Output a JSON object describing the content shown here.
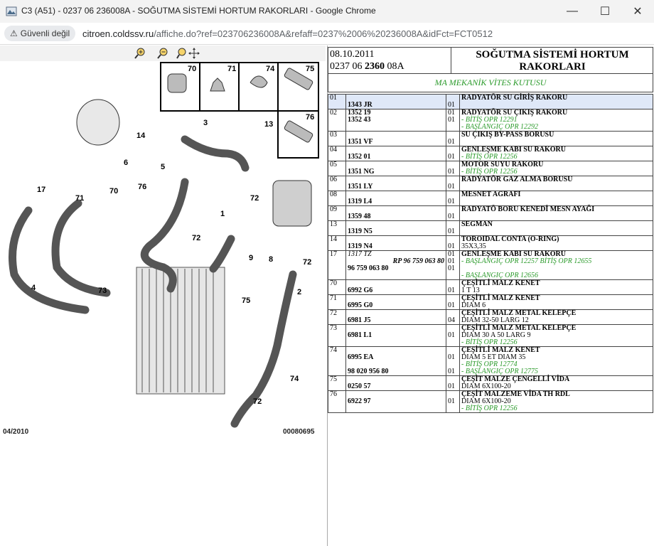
{
  "window": {
    "title": "C3 (A51) - 0237 06 236008A - SOĞUTMA SİSTEMİ HORTUM RAKORLARI - Google Chrome",
    "minimize": "—",
    "maximize": "☐",
    "close": "✕"
  },
  "address": {
    "secure_label": "Güvenli değil",
    "host": "citroen.coldssv.ru",
    "path": "/affiche.do?ref=023706236008A&refaff=0237%2006%20236008A&idFct=FCT0512"
  },
  "diagram": {
    "labels": {
      "l70a": "70",
      "l71a": "71",
      "l74a": "74",
      "l75a": "75",
      "l76a": "76",
      "l3": "3",
      "l13": "13",
      "l14": "14",
      "l6": "6",
      "l5": "5",
      "l17": "17",
      "l71": "71",
      "l70": "70",
      "l76": "76",
      "l72a": "72",
      "l1": "1",
      "l72b": "72",
      "l72c": "72",
      "l9": "9",
      "l8": "8",
      "l75": "75",
      "l4": "4",
      "l73": "73",
      "l2": "2",
      "l74": "74",
      "l72d": "72"
    },
    "date_code": "04/2010",
    "image_code": "00080695"
  },
  "header": {
    "date": "08.10.2011",
    "ref_a": "0237 06 ",
    "ref_b": "2360",
    "ref_c": " 08A",
    "title_line1": "SOĞUTMA SİSTEMİ HORTUM",
    "title_line2": "RAKORLARI",
    "subtitle": "MA MEKANİK VİTES KUTUSU"
  },
  "parts": [
    {
      "num": "01",
      "refs": [
        "",
        "1343 JR"
      ],
      "qty": [
        "",
        "01"
      ],
      "desc": "RADYATÖR SU GİRİŞ RAKORU",
      "notes": [],
      "selected": true
    },
    {
      "num": "02",
      "refs": [
        "1352 19",
        "1352 43"
      ],
      "qty": [
        "01",
        "01"
      ],
      "desc": "RADYATÖR SU ÇIKIŞ RAKORU",
      "notes": [
        "- BİTİŞ OPR 12291",
        "- BAŞLANGIÇ OPR 12292"
      ]
    },
    {
      "num": "03",
      "refs": [
        "",
        "1351 VF"
      ],
      "qty": [
        "",
        "01"
      ],
      "desc": "SU ÇIKIŞ BY-PASS BORUSU",
      "notes": []
    },
    {
      "num": "04",
      "refs": [
        "",
        "1352 01"
      ],
      "qty": [
        "",
        "01"
      ],
      "desc": "GENLEŞME KABI SU RAKORU",
      "notes": [
        "- BİTİŞ OPR 12256"
      ]
    },
    {
      "num": "05",
      "refs": [
        "",
        "1351 NG"
      ],
      "qty": [
        "",
        "01"
      ],
      "desc": "MOTOR SUYU RAKORU",
      "notes": [
        "- BİTİŞ OPR 12256"
      ]
    },
    {
      "num": "06",
      "refs": [
        "",
        "1351 LY"
      ],
      "qty": [
        "",
        "01"
      ],
      "desc": "RADYATÖR GAZ ALMA BORUSU",
      "notes": []
    },
    {
      "num": "08",
      "refs": [
        "",
        "1319 L4"
      ],
      "qty": [
        "",
        "01"
      ],
      "desc": "MESNET AGRAFI",
      "notes": []
    },
    {
      "num": "09",
      "refs": [
        "",
        "1359 48"
      ],
      "qty": [
        "",
        "01"
      ],
      "desc": "RADYATÖ BORU KENEDİ MESN AYAĞI",
      "notes": []
    },
    {
      "num": "13",
      "refs": [
        "",
        "1319 N5"
      ],
      "qty": [
        "",
        "01"
      ],
      "desc": "SEGMAN",
      "notes": []
    },
    {
      "num": "14",
      "refs": [
        "",
        "1319 N4"
      ],
      "qty": [
        "",
        "01"
      ],
      "desc": "TOROIDAL CONTA (O-RING)",
      "extra": "35X3,35",
      "notes": []
    }
  ],
  "part17": {
    "num": "17",
    "ref1": "1317 TZ",
    "ref2": "RP 96 759 063 80",
    "ref3": "96 759 063 80",
    "q1": "01",
    "q2": "01",
    "q3": "01",
    "desc": "GENLEŞME KABI SU RAKORU",
    "note1": "- BAŞLANGIÇ OPR 12257 BİTİŞ OPR 12655",
    "note3": "- BAŞLANGIÇ OPR 12656"
  },
  "parts2": [
    {
      "num": "70",
      "ref": "6992 G6",
      "qty": "01",
      "desc": "ÇEŞİTLİ MALZ KENET",
      "extra": "1 T 13"
    },
    {
      "num": "71",
      "ref": "6995 G0",
      "qty": "01",
      "desc": "ÇEŞİTLİ MALZ KENET",
      "extra": "DIAM 6"
    },
    {
      "num": "72",
      "ref": "6981 J5",
      "qty": "04",
      "desc": "ÇEŞİTLİ MALZ METAL KELEPÇE",
      "extra": "DIAM 32-50 LARG 12"
    },
    {
      "num": "73",
      "ref": "6981 L1",
      "qty": "01",
      "desc": "ÇEŞİTLİ MALZ METAL KELEPÇE",
      "extra": "DIAM 30 A 50 LARG 9",
      "note": "- BİTİŞ OPR 12256"
    }
  ],
  "part74": {
    "num": "74",
    "ref1": "6995 EA",
    "ref2": "98 020 956 80",
    "q1": "01",
    "q2": "01",
    "desc": "ÇEŞİTLİ MALZ KENET",
    "extra": "DIAM 5 ET DIAM 35",
    "note1": "- BİTİŞ OPR 12774",
    "note2": "- BAŞLANGIÇ OPR 12775"
  },
  "part75": {
    "num": "75",
    "ref": "0250 57",
    "qty": "01",
    "desc": "ÇEŞİT MALZE ÇENGELLİ VİDA",
    "extra": "DIAM 6X100-20"
  },
  "part76": {
    "num": "76",
    "ref": "6922 97",
    "qty": "01",
    "desc": "ÇEŞİT MALZEME VİDA TH RDL",
    "extra": "DIAM 6X100-20",
    "note": "- BİTİŞ OPR 12256"
  }
}
